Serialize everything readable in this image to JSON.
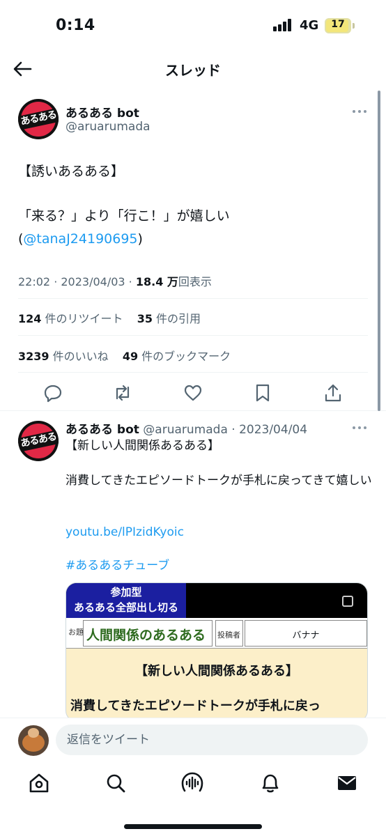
{
  "status_bar": {
    "time": "0:14",
    "network": "4G",
    "battery": "17"
  },
  "header": {
    "title": "スレッド",
    "back_icon": "arrow-left-icon"
  },
  "main_tweet": {
    "avatar_text": "あるある",
    "name": "あるある bot",
    "handle": "@aruarumada",
    "line1": "【誘いあるある】",
    "line2": "「来る？」より「行こ！」が嬉しい",
    "line3_open": "(",
    "mention": "@tanaJ24190695",
    "line3_close": ")",
    "time": "22:02 · 2023/04/03 · ",
    "views_count": "18.4 万",
    "views_label": "回表示",
    "retweets_count": "124",
    "retweets_label": " 件のリツイート",
    "quotes_count": "35",
    "quotes_label": " 件の引用",
    "likes_count": "3239",
    "likes_label": " 件のいいね",
    "bookmarks_count": "49",
    "bookmarks_label": " 件のブックマーク"
  },
  "reply_tweet": {
    "avatar_text": "あるある",
    "name": "あるある bot",
    "handle_date": " @aruarumada · 2023/04/04",
    "line1": "【新しい人間関係あるある】",
    "line2": "消費してきたエピソードトークが手札に戻ってきて嬉しい",
    "link": "youtu.be/lPIzidKyoic",
    "hashtag": "#あるあるチューブ",
    "media": {
      "tag_line1": "参加型",
      "tag_line2": "あるある全部出し切る",
      "topic_label": "お題",
      "topic": "人間関係のあるある",
      "poster_label": "投稿者",
      "poster": "バナナ",
      "title": "【新しい人間関係あるある】",
      "subtitle": "消費してきたエピソードトークが手札に戻っ"
    }
  },
  "reply_bar": {
    "placeholder": "返信をツイート"
  },
  "nav": {
    "items": [
      "home-icon",
      "search-icon",
      "spaces-icon",
      "notifications-icon",
      "messages-icon"
    ]
  },
  "colors": {
    "accent": "#1d9bf0",
    "text": "#0f1419",
    "muted": "#536471"
  }
}
